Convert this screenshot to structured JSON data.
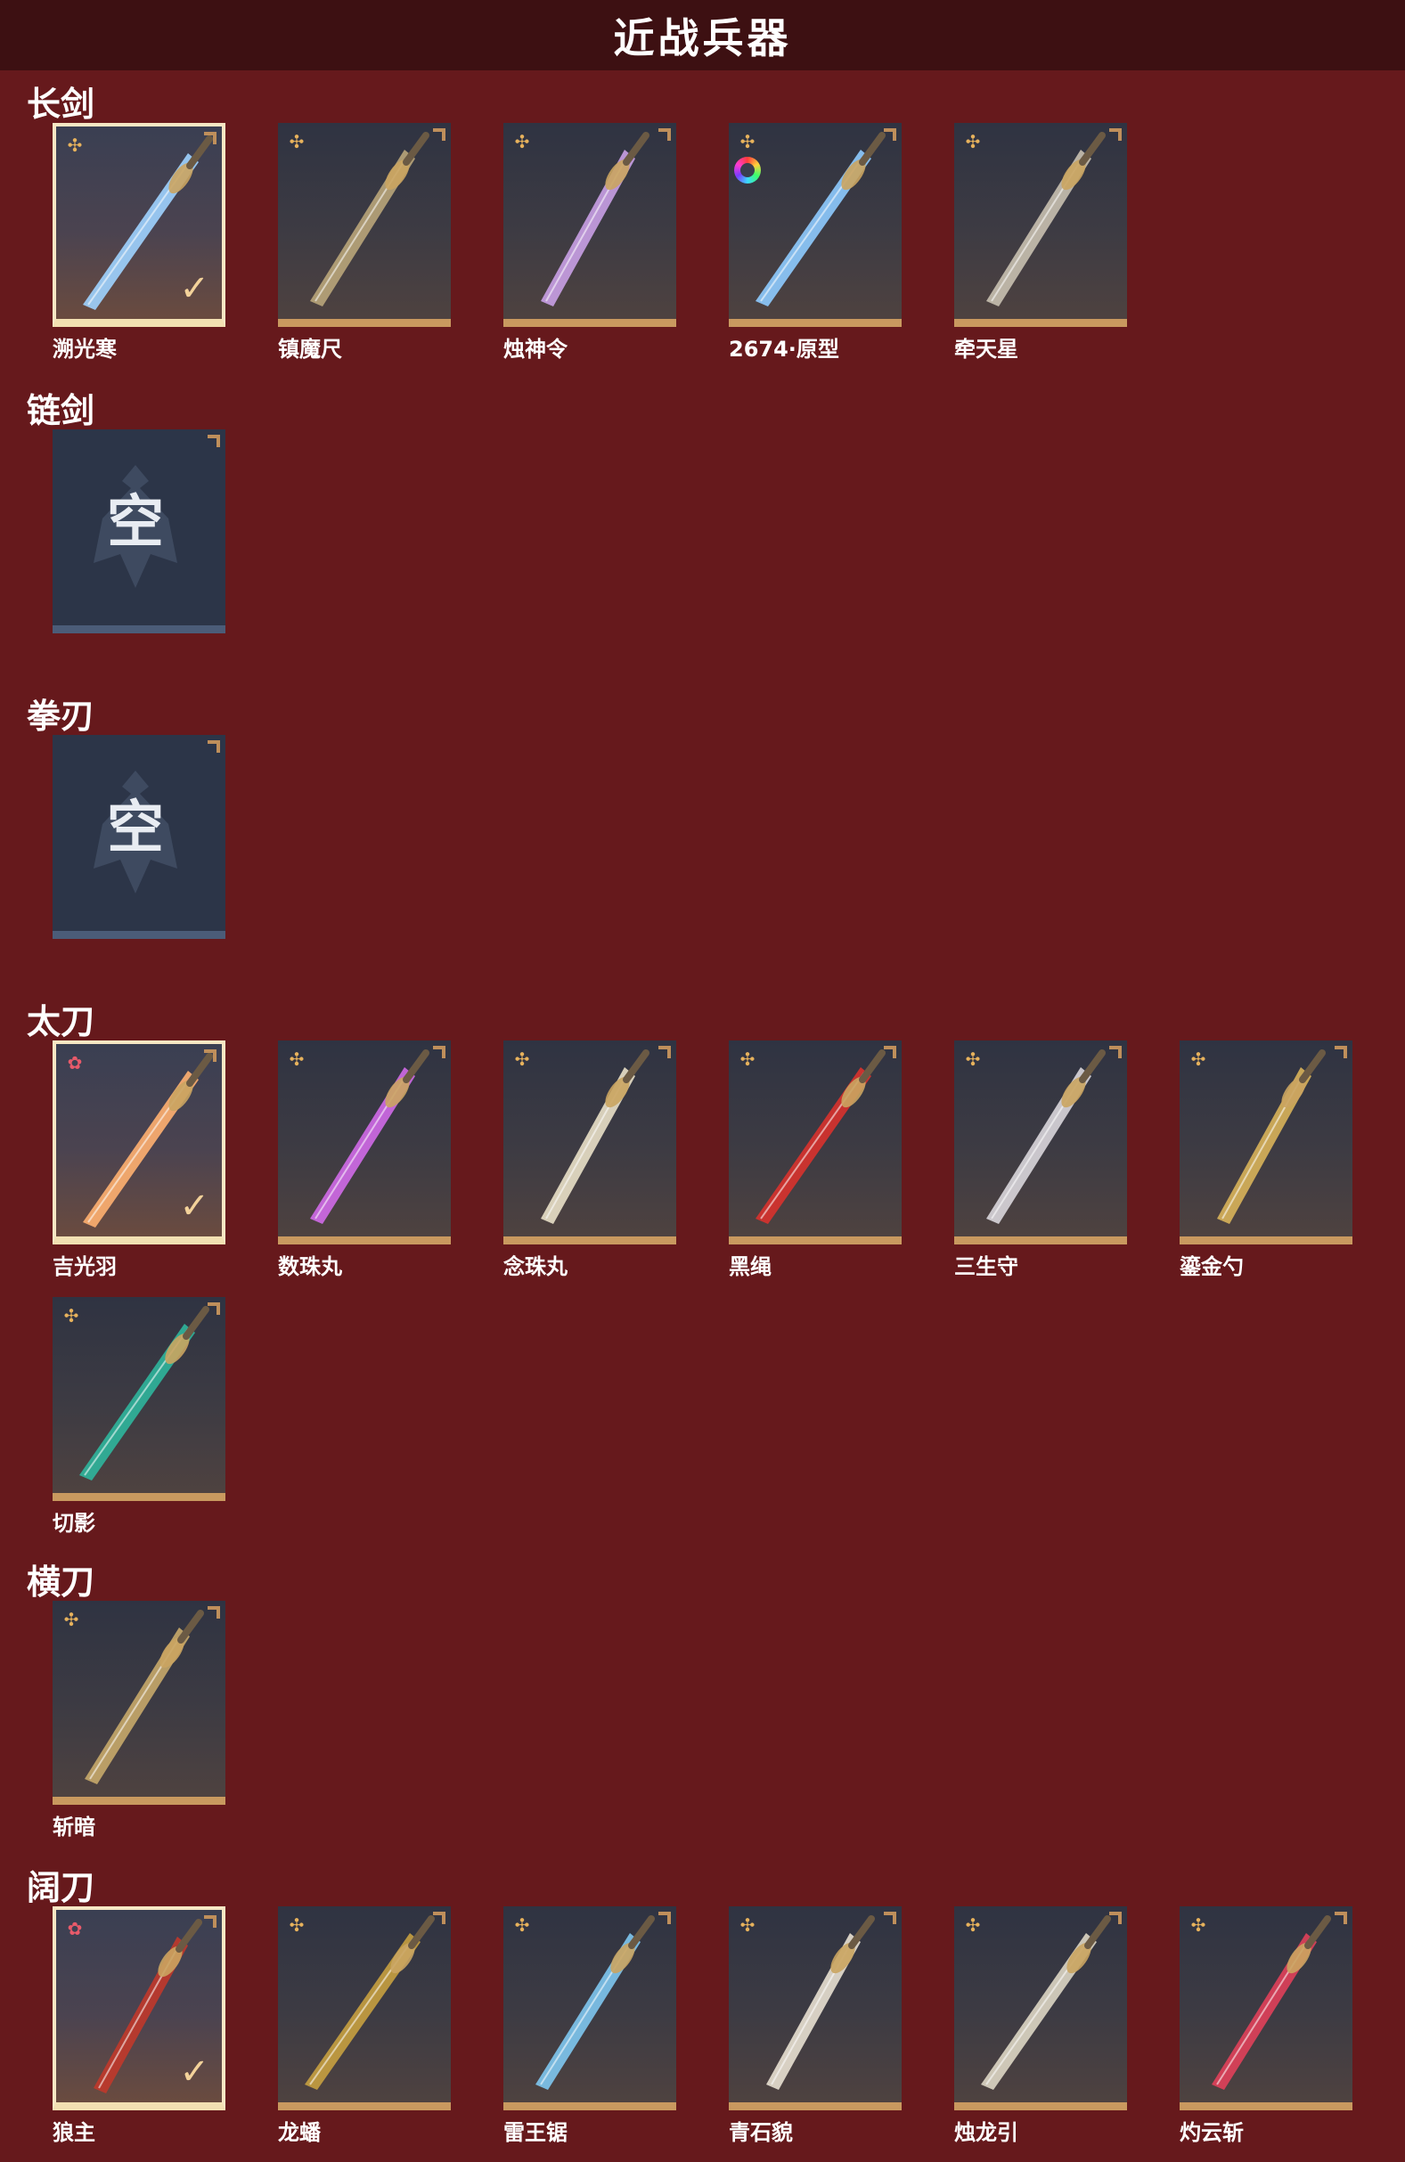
{
  "header": {
    "title": "近战兵器"
  },
  "sections": [
    {
      "title": "长剑",
      "items": [
        {
          "name": "溯光寒",
          "rarity_icon": "gold-flower-icon",
          "selected": true,
          "blade_color": "#9fd3ff"
        },
        {
          "name": "镇魔尺",
          "rarity_icon": "gold-flower-icon",
          "selected": false,
          "blade_color": "#b9a57a"
        },
        {
          "name": "烛神令",
          "rarity_icon": "gold-flower-icon",
          "selected": false,
          "blade_color": "#c9a0e6"
        },
        {
          "name": "2674·原型",
          "rarity_icon": "gold-flower-icon",
          "selected": false,
          "blade_color": "#8ecbff",
          "extra_icon": "rainbow-ring-icon"
        },
        {
          "name": "牵天星",
          "rarity_icon": "gold-flower-icon",
          "selected": false,
          "blade_color": "#c8c0b0"
        }
      ]
    },
    {
      "title": "链剑",
      "items": [
        {
          "name": "",
          "empty_label": "空"
        }
      ]
    },
    {
      "title": "拳刃",
      "items": [
        {
          "name": "",
          "empty_label": "空"
        }
      ]
    },
    {
      "title": "太刀",
      "items": [
        {
          "name": "吉光羽",
          "rarity_icon": "red-flower-icon",
          "selected": true,
          "blade_color": "#ffb070"
        },
        {
          "name": "数珠丸",
          "rarity_icon": "gold-flower-icon",
          "selected": false,
          "blade_color": "#d06ae8"
        },
        {
          "name": "念珠丸",
          "rarity_icon": "gold-flower-icon",
          "selected": false,
          "blade_color": "#e9e0c8"
        },
        {
          "name": "黑绳",
          "rarity_icon": "gold-flower-icon",
          "selected": false,
          "blade_color": "#d8322e"
        },
        {
          "name": "三生守",
          "rarity_icon": "gold-flower-icon",
          "selected": false,
          "blade_color": "#d9d6dc"
        },
        {
          "name": "鎏金勺",
          "rarity_icon": "gold-flower-icon",
          "selected": false,
          "blade_color": "#d8b35a"
        },
        {
          "name": "切影",
          "rarity_icon": "gold-flower-icon",
          "selected": false,
          "blade_color": "#2fb59c"
        }
      ]
    },
    {
      "title": "横刀",
      "items": [
        {
          "name": "斩暗",
          "rarity_icon": "gold-flower-icon",
          "selected": false,
          "blade_color": "#c6a86a"
        }
      ]
    },
    {
      "title": "阔刀",
      "items": [
        {
          "name": "狼主",
          "rarity_icon": "red-flower-icon",
          "selected": true,
          "blade_color": "#c0392b"
        },
        {
          "name": "龙蟠",
          "rarity_icon": "gold-flower-icon",
          "selected": false,
          "blade_color": "#c6a040"
        },
        {
          "name": "雷王锯",
          "rarity_icon": "gold-flower-icon",
          "selected": false,
          "blade_color": "#7ec6f0"
        },
        {
          "name": "青石貌",
          "rarity_icon": "gold-flower-icon",
          "selected": false,
          "blade_color": "#e8e0d2"
        },
        {
          "name": "烛龙引",
          "rarity_icon": "gold-flower-icon",
          "selected": false,
          "blade_color": "#ddd6c4"
        },
        {
          "name": "灼云斩",
          "rarity_icon": "gold-flower-icon",
          "selected": false,
          "blade_color": "#e0405a"
        }
      ]
    }
  ],
  "check_glyph": "✓",
  "colors": {
    "background": "#66191c",
    "header": "#3d1012",
    "card_border": "#c9995f",
    "selected_border": "#f6e7c4"
  }
}
